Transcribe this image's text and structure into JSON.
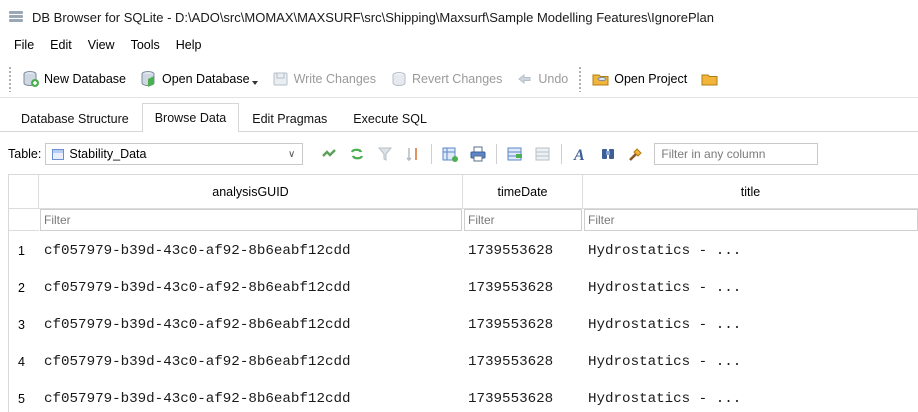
{
  "window": {
    "title": "DB Browser for SQLite - D:\\ADO\\src\\MOMAX\\MAXSURF\\src\\Shipping\\Maxsurf\\Sample Modelling Features\\IgnorePlan"
  },
  "menu": [
    "File",
    "Edit",
    "View",
    "Tools",
    "Help"
  ],
  "toolbar": {
    "new_database": "New Database",
    "open_database": "Open Database",
    "write_changes": "Write Changes",
    "revert_changes": "Revert Changes",
    "undo": "Undo",
    "open_project": "Open Project"
  },
  "tabs": [
    "Database Structure",
    "Browse Data",
    "Edit Pragmas",
    "Execute SQL"
  ],
  "active_tab": "Browse Data",
  "browse": {
    "table_label": "Table:",
    "table_name": "Stability_Data",
    "filter_placeholder": "Filter in any column"
  },
  "grid": {
    "columns": [
      "analysisGUID",
      "timeDate",
      "title"
    ],
    "filter_placeholder": "Filter",
    "rows": [
      {
        "num": "1",
        "analysisGUID": "cf057979-b39d-43c0-af92-8b6eabf12cdd",
        "timeDate": "1739553628",
        "title": "Hydrostatics - ..."
      },
      {
        "num": "2",
        "analysisGUID": "cf057979-b39d-43c0-af92-8b6eabf12cdd",
        "timeDate": "1739553628",
        "title": "Hydrostatics - ..."
      },
      {
        "num": "3",
        "analysisGUID": "cf057979-b39d-43c0-af92-8b6eabf12cdd",
        "timeDate": "1739553628",
        "title": "Hydrostatics - ..."
      },
      {
        "num": "4",
        "analysisGUID": "cf057979-b39d-43c0-af92-8b6eabf12cdd",
        "timeDate": "1739553628",
        "title": "Hydrostatics - ..."
      },
      {
        "num": "5",
        "analysisGUID": "cf057979-b39d-43c0-af92-8b6eabf12cdd",
        "timeDate": "1739553628",
        "title": "Hydrostatics - ..."
      }
    ]
  },
  "colors": {
    "tab_border": "#d6d6d6",
    "grid_line": "#dcdcdc",
    "disabled_text": "#9a9a9a"
  }
}
